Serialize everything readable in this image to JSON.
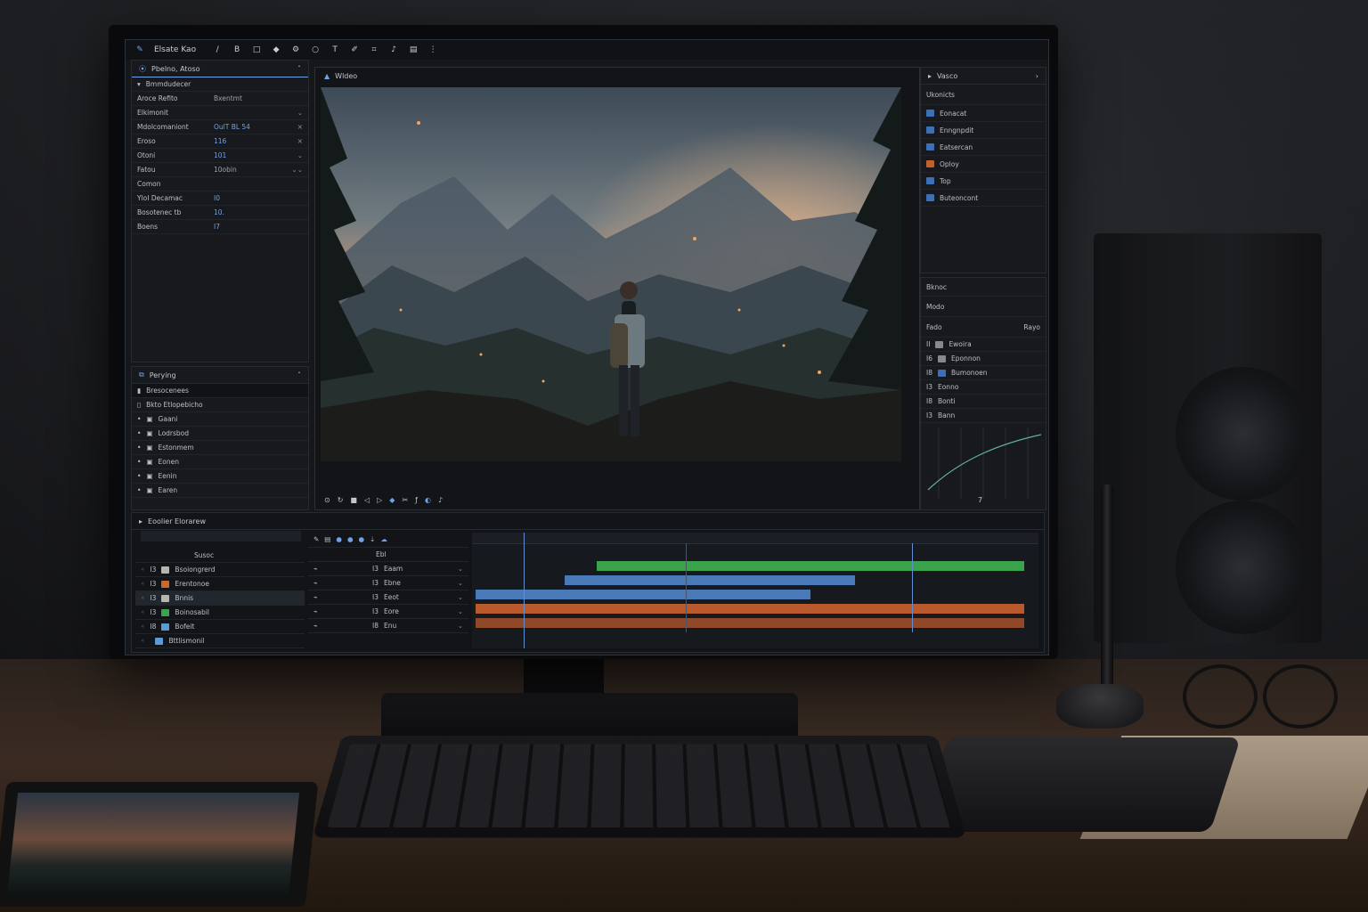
{
  "toolbar": {
    "app_title": "Elsate Kao",
    "tools": [
      "pen-tool-icon",
      "bold-tool-icon",
      "square-tool-icon",
      "paint-icon",
      "gear-icon",
      "lasso-icon",
      "text-icon",
      "brush-icon",
      "crop-icon",
      "note-icon",
      "grid-icon"
    ]
  },
  "properties_panel": {
    "tab_label": "Pbelno, Atoso",
    "section": "Bmmdudecer",
    "rows": [
      {
        "label": "Aroce Refito",
        "value": "Bxentmt",
        "ctl": ""
      },
      {
        "label": "Elkimonit",
        "value": "",
        "ctl": "⌄"
      },
      {
        "label": "Mdolcomaniont",
        "value": "OulT BL 54",
        "ctl": "×"
      },
      {
        "label": "Eroso",
        "value": "116",
        "ctl": "×"
      },
      {
        "label": "Otoni",
        "value": "101",
        "ctl": "⌄"
      },
      {
        "label": "Fatou",
        "value": "10obin",
        "ctl": "⌄⌄"
      },
      {
        "label": "Comon",
        "value": "",
        "ctl": ""
      },
      {
        "label": "YloI Decamac",
        "value": "I0",
        "ctl": ""
      },
      {
        "label": "Bosotenec tb",
        "value": "10.",
        "ctl": ""
      },
      {
        "label": "Boens",
        "value": "I7",
        "ctl": ""
      }
    ]
  },
  "layers_panel": {
    "title": "Perying",
    "search_label": "Bresocenees",
    "group_label": "Bkto Etlopebicho",
    "items": [
      "Gaani",
      "Lodrsbod",
      "Estonmem",
      "Eonen",
      "Eenin",
      "Earen"
    ]
  },
  "viewer": {
    "title": "Wldeo",
    "controls": [
      "play-icon",
      "loop-icon",
      "stop-icon",
      "frame-back-icon",
      "frame-forward-icon",
      "marker-icon",
      "trim-icon",
      "fx-icon",
      "mask-icon",
      "audio-icon"
    ]
  },
  "right_panel": {
    "header": "Vasco",
    "sub_label": "Ukonicts",
    "items": [
      {
        "label": "Eonacat",
        "color": "#3d6fb5"
      },
      {
        "label": "Enngnpdit",
        "color": "#3d6fb5"
      },
      {
        "label": "Eatsercan",
        "color": "#3d6fb5"
      },
      {
        "label": "Oploy",
        "color": "#c0622c"
      },
      {
        "label": "Top",
        "color": "#3d6fb5"
      },
      {
        "label": "Buteoncont",
        "color": "#3d6fb5"
      }
    ],
    "section2": "Bknoc",
    "field1": "Modo",
    "field2": "Fado",
    "field2_extra": "Rayo",
    "keys": [
      {
        "code": "II",
        "label": "Ewoira"
      },
      {
        "code": "I6",
        "label": "Eponnon"
      },
      {
        "code": "I8",
        "label": "Bumonoen"
      },
      {
        "code": "I3",
        "label": "Eonno"
      },
      {
        "code": "I8",
        "label": "Bonti"
      },
      {
        "code": "I3",
        "label": "Bann"
      }
    ],
    "graph_footer": "7"
  },
  "timeline": {
    "title": "Eoolier Elorarew",
    "track_header": "Susoc",
    "tracks": [
      {
        "label": "Bsoiongrerd",
        "color": "#b7b3ad",
        "num": "I3",
        "prop": "Eaam"
      },
      {
        "label": "Erentonoe",
        "color": "#c8692a",
        "num": "I3",
        "prop": "Ebne"
      },
      {
        "label": "Bnnis",
        "color": "#b7b3ad",
        "num": "I3",
        "prop": "Eeot"
      },
      {
        "label": "Boinosabil",
        "color": "#3aa34b",
        "num": "I3",
        "prop": "Eore"
      },
      {
        "label": "Bofeit",
        "color": "#5a9bd6",
        "num": "I8",
        "prop": "Enu"
      },
      {
        "label": "Bttlismonil",
        "color": "#5a9bd6",
        "num": "",
        "prop": ""
      }
    ],
    "mid_header": "Ebl"
  },
  "colors": {
    "accent_blue": "#6fa3e8",
    "clip_green": "#3aa34b",
    "clip_blue": "#4a79b8",
    "clip_orange": "#b85a2c"
  }
}
